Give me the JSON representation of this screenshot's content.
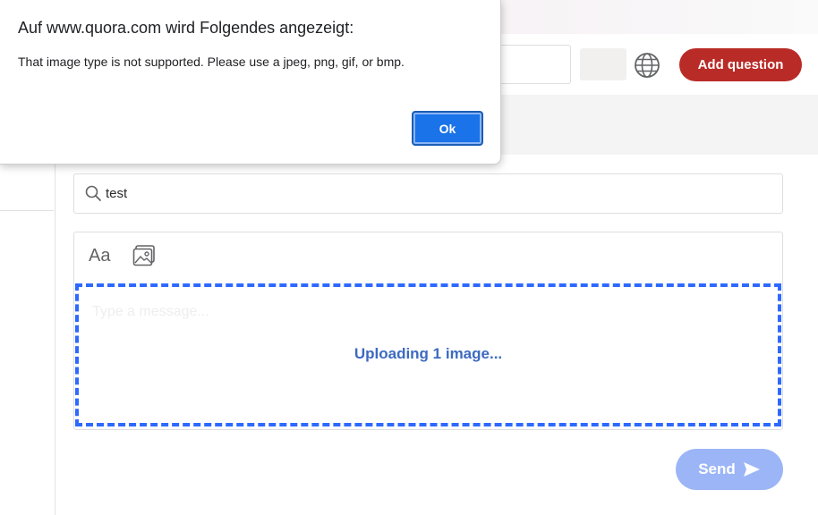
{
  "header": {
    "add_question_label": "Add question",
    "globe_icon": "globe-icon"
  },
  "search": {
    "value": "test",
    "icon": "search-icon"
  },
  "composer": {
    "format_label": "Aa",
    "image_icon": "image-icon",
    "placeholder": "Type a message...",
    "uploading_text": "Uploading 1 image...",
    "send_label": "Send",
    "send_icon": "paper-plane-icon"
  },
  "dialog": {
    "title": "Auf www.quora.com wird Folgendes angezeigt:",
    "message": "That image type is not supported. Please use a jpeg, png, gif, or bmp.",
    "ok_label": "Ok"
  },
  "colors": {
    "brand": "#b92b27",
    "accent_blue": "#2e69ff",
    "dialog_button": "#1a73e8",
    "send_disabled": "#9bb5f7"
  }
}
